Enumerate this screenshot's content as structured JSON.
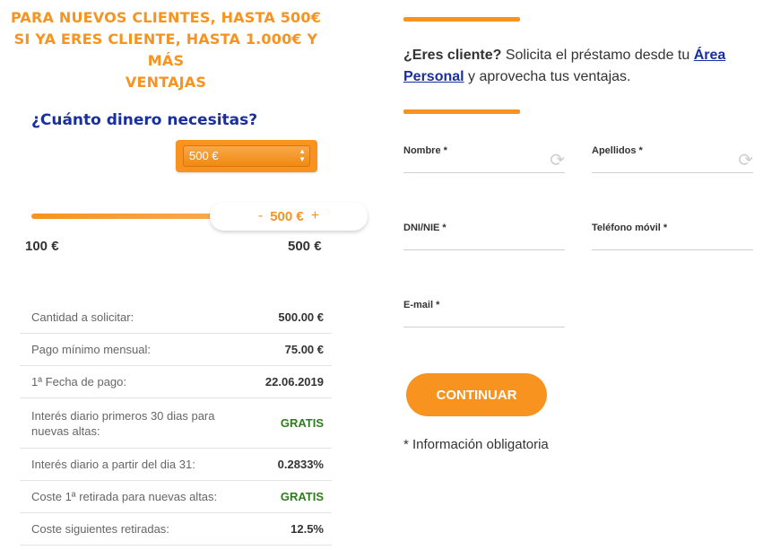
{
  "promo": {
    "line1": "PARA NUEVOS CLIENTES, HASTA 500€",
    "line2": "SI YA ERES CLIENTE, HASTA 1.000€ Y MÁS",
    "line3": "VENTAJAS"
  },
  "calculator": {
    "question": "¿Cuánto dinero necesitas?",
    "select_value": "500 €",
    "slider_value": "500 €",
    "minus_label": "-",
    "plus_label": "+",
    "min_label": "100 €",
    "max_label": "500 €"
  },
  "summary": [
    {
      "label": "Cantidad a solicitar:",
      "value": "500.00 €"
    },
    {
      "label": "Pago mínimo mensual:",
      "value": "75.00 €"
    },
    {
      "label": "1ª Fecha de pago:",
      "value": "22.06.2019"
    },
    {
      "label": "Interés diario primeros 30 dias para nuevas altas:",
      "value": "GRATIS"
    },
    {
      "label": "Interés diario a partir del dia 31:",
      "value": "0.2833%"
    },
    {
      "label": "Coste 1ª retirada para nuevas altas:",
      "value": "GRATIS"
    },
    {
      "label": "Coste siguientes retiradas:",
      "value": "12.5%"
    }
  ],
  "client": {
    "question": "¿Eres cliente?",
    "text_before": " Solicita el préstamo desde tu ",
    "link": "Área Personal",
    "text_after": " y aprovecha tus ventajas."
  },
  "form": {
    "nombre_label": "Nombre *",
    "apellidos_label": "Apellidos *",
    "dni_label": "DNI/NIE *",
    "telefono_label": "Teléfono móvil *",
    "email_label": "E-mail *",
    "continue_label": "CONTINUAR",
    "required_note": "* Información obligatoria"
  },
  "colors": {
    "accent": "#f7931e",
    "heading_blue": "#1a2f9e",
    "free_green": "#2e7d1c"
  }
}
